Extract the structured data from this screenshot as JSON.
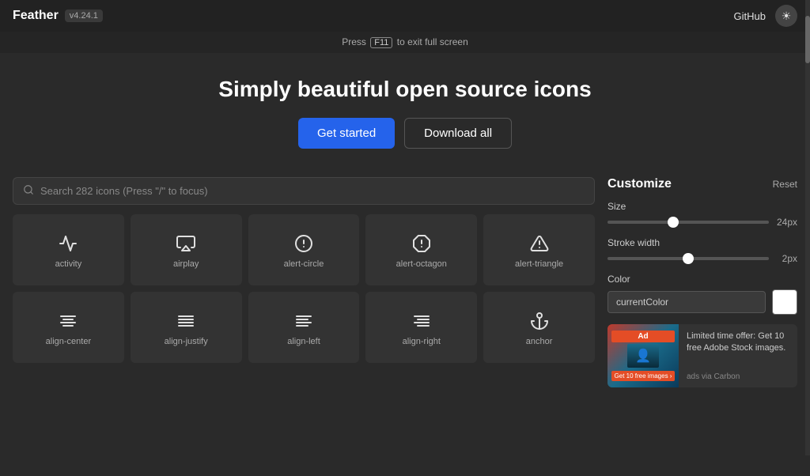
{
  "topbar": {
    "app_name": "Feather",
    "version": "v4.24.1",
    "github_label": "GitHub",
    "theme_icon": "☀"
  },
  "browser_notice": {
    "prefix": "Press",
    "key": "F11",
    "suffix": "to exit full screen"
  },
  "hero": {
    "title": "Simply beautiful open source icons",
    "btn_get_started": "Get started",
    "btn_download_all": "Download all"
  },
  "search": {
    "placeholder": "Search 282 icons (Press \"/\" to focus)"
  },
  "customize": {
    "title": "Customize",
    "reset_label": "Reset",
    "size_label": "Size",
    "size_value": "24px",
    "size_slider_val": 40,
    "stroke_label": "Stroke width",
    "stroke_value": "2px",
    "stroke_slider_val": 50,
    "color_label": "Color",
    "color_value": "currentColor"
  },
  "ad": {
    "adobe_badge": "Ad",
    "description": "Limited time offer: Get 10 free Adobe Stock images.",
    "via": "ads via Carbon",
    "cta": "Get 10 free images ›"
  },
  "icons": [
    {
      "name": "activity",
      "row": 0
    },
    {
      "name": "airplay",
      "row": 0
    },
    {
      "name": "alert-circle",
      "row": 0
    },
    {
      "name": "alert-octagon",
      "row": 0
    },
    {
      "name": "alert-triangle",
      "row": 0
    },
    {
      "name": "align-center",
      "row": 1
    },
    {
      "name": "align-justify",
      "row": 1
    },
    {
      "name": "align-left",
      "row": 1
    },
    {
      "name": "align-right",
      "row": 1
    },
    {
      "name": "anchor",
      "row": 1
    }
  ]
}
